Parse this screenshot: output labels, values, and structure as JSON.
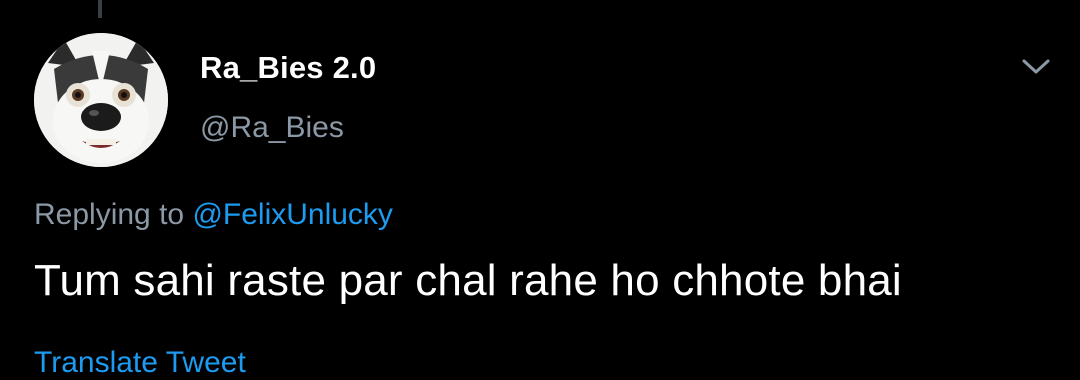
{
  "author": {
    "display_name": "Ra_Bies 2.0",
    "handle": "@Ra_Bies",
    "avatar_icon": "husky-dog-avatar"
  },
  "reply": {
    "prefix": "Replying to",
    "mention": "@FelixUnlucky"
  },
  "tweet": {
    "text": "Tum sahi raste par chal rahe ho chhote bhai"
  },
  "footer": {
    "translate_label": "Translate Tweet"
  },
  "icons": {
    "menu": "chevron-down-icon"
  },
  "colors": {
    "background": "#000000",
    "primary_text": "#ffffff",
    "secondary_text": "#8b98a5",
    "link": "#1d9bf0"
  }
}
